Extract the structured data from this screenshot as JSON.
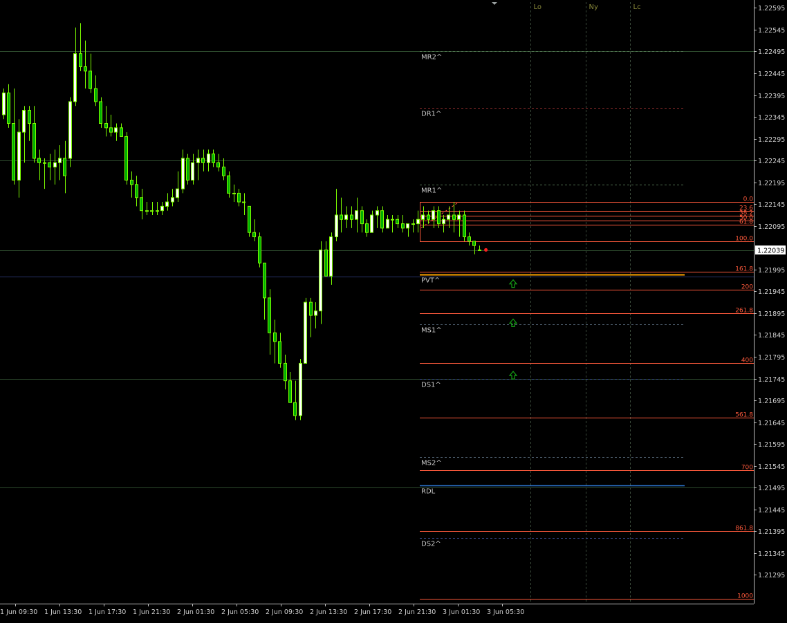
{
  "window": {
    "current_price": "1.22039"
  },
  "colors": {
    "background": "#000000",
    "candle": "#7CFC00",
    "bull_body": "#ffffff",
    "bear_body": "#00b000",
    "fib": "#ff5a3c",
    "pivot_label": "#c8c8c8",
    "session_label": "#8a8a3a",
    "pvt_line": "#ffa500",
    "rdl_line": "#2e7bd6",
    "arrow": "#15a015"
  },
  "chart_data": {
    "type": "candlestick",
    "title": "",
    "xlabel": "",
    "ylabel": "",
    "ylim": [
      1.21229,
      1.22613
    ],
    "grid": false,
    "y_ticks": [
      "1.22595",
      "1.22545",
      "1.22495",
      "1.22445",
      "1.22395",
      "1.22345",
      "1.22295",
      "1.22245",
      "1.22195",
      "1.22145",
      "1.22095",
      "1.21995",
      "1.21945",
      "1.21895",
      "1.21845",
      "1.21795",
      "1.21745",
      "1.21695",
      "1.21645",
      "1.21595",
      "1.21545",
      "1.21495",
      "1.21445",
      "1.21395",
      "1.21345",
      "1.21295"
    ],
    "x_ticks": [
      "1 Jun 09:30",
      "1 Jun 13:30",
      "1 Jun 17:30",
      "1 Jun 21:30",
      "2 Jun 01:30",
      "2 Jun 05:30",
      "2 Jun 09:30",
      "2 Jun 13:30",
      "2 Jun 17:30",
      "2 Jun 21:30",
      "3 Jun 01:30",
      "3 Jun 05:30"
    ],
    "candles": [
      [
        1.2234,
        1.2241,
        1.2235,
        1.224
      ],
      [
        1.2232,
        1.2242,
        1.224,
        1.2233
      ],
      [
        1.2219,
        1.2241,
        1.2233,
        1.222
      ],
      [
        1.2216,
        1.2234,
        1.222,
        1.2231
      ],
      [
        1.2224,
        1.2237,
        1.2231,
        1.2236
      ],
      [
        1.2229,
        1.2237,
        1.2236,
        1.2233
      ],
      [
        1.2224,
        1.2237,
        1.2233,
        1.2225
      ],
      [
        1.222,
        1.2227,
        1.2225,
        1.2224
      ],
      [
        1.2218,
        1.2225,
        1.2224,
        1.2224
      ],
      [
        1.222,
        1.2226,
        1.2224,
        1.2223
      ],
      [
        1.2219,
        1.2227,
        1.2223,
        1.2224
      ],
      [
        1.222,
        1.2228,
        1.2224,
        1.2225
      ],
      [
        1.2217,
        1.2229,
        1.2225,
        1.2221
      ],
      [
        1.2223,
        1.2239,
        1.2225,
        1.2238
      ],
      [
        1.2237,
        1.2255,
        1.2238,
        1.2249
      ],
      [
        1.2245,
        1.2256,
        1.2249,
        1.2246
      ],
      [
        1.2241,
        1.2252,
        1.2246,
        1.2245
      ],
      [
        1.224,
        1.2249,
        1.2245,
        1.2241
      ],
      [
        1.2237,
        1.2244,
        1.2241,
        1.2238
      ],
      [
        1.2232,
        1.2239,
        1.2238,
        1.2233
      ],
      [
        1.223,
        1.2237,
        1.2233,
        1.2232
      ],
      [
        1.223,
        1.2235,
        1.2232,
        1.2231
      ],
      [
        1.2229,
        1.2233,
        1.2231,
        1.2232
      ],
      [
        1.223,
        1.2233,
        1.2232,
        1.223
      ],
      [
        1.2219,
        1.2231,
        1.223,
        1.222
      ],
      [
        1.2216,
        1.2222,
        1.222,
        1.2219
      ],
      [
        1.2214,
        1.2221,
        1.2219,
        1.2216
      ],
      [
        1.2211,
        1.2218,
        1.2216,
        1.2213
      ],
      [
        1.2212,
        1.2215,
        1.2213,
        1.2213
      ],
      [
        1.2212,
        1.2215,
        1.2213,
        1.2213
      ],
      [
        1.2212,
        1.2215,
        1.2213,
        1.2213
      ],
      [
        1.2212,
        1.2215,
        1.2213,
        1.2214
      ],
      [
        1.2213,
        1.2217,
        1.2214,
        1.2215
      ],
      [
        1.2214,
        1.2218,
        1.2215,
        1.2216
      ],
      [
        1.2215,
        1.2222,
        1.2216,
        1.2218
      ],
      [
        1.2217,
        1.2227,
        1.2218,
        1.2225
      ],
      [
        1.2219,
        1.2226,
        1.2225,
        1.222
      ],
      [
        1.2219,
        1.2226,
        1.222,
        1.2224
      ],
      [
        1.222,
        1.2227,
        1.2224,
        1.2225
      ],
      [
        1.2222,
        1.2227,
        1.2225,
        1.2224
      ],
      [
        1.2222,
        1.2227,
        1.2224,
        1.2226
      ],
      [
        1.2223,
        1.2227,
        1.2226,
        1.2224
      ],
      [
        1.2222,
        1.2226,
        1.2224,
        1.2223
      ],
      [
        1.222,
        1.2225,
        1.2223,
        1.2221
      ],
      [
        1.2216,
        1.2222,
        1.2221,
        1.2217
      ],
      [
        1.2215,
        1.2219,
        1.2217,
        1.2217
      ],
      [
        1.2214,
        1.2218,
        1.2217,
        1.2215
      ],
      [
        1.2212,
        1.2217,
        1.2215,
        1.2215
      ],
      [
        1.2207,
        1.2214,
        1.2214,
        1.2208
      ],
      [
        1.2206,
        1.2211,
        1.2208,
        1.2207
      ],
      [
        1.22,
        1.2208,
        1.2207,
        1.2201
      ],
      [
        1.2188,
        1.2201,
        1.2201,
        1.2193
      ],
      [
        1.218,
        1.2195,
        1.2193,
        1.2185
      ],
      [
        1.2178,
        1.2188,
        1.2185,
        1.2183
      ],
      [
        1.2177,
        1.2185,
        1.2183,
        1.2178
      ],
      [
        1.2172,
        1.218,
        1.2178,
        1.2174
      ],
      [
        1.2169,
        1.2176,
        1.2174,
        1.2169
      ],
      [
        1.2165,
        1.2174,
        1.2169,
        1.2166
      ],
      [
        1.2165,
        1.2179,
        1.2166,
        1.2178
      ],
      [
        1.2178,
        1.2193,
        1.2178,
        1.2192
      ],
      [
        1.2184,
        1.2193,
        1.2192,
        1.2189
      ],
      [
        1.2186,
        1.2192,
        1.2189,
        1.219
      ],
      [
        1.2187,
        1.2206,
        1.219,
        1.2204
      ],
      [
        1.2198,
        1.2206,
        1.2204,
        1.2198
      ],
      [
        1.2196,
        1.2208,
        1.2198,
        1.2207
      ],
      [
        1.2206,
        1.2218,
        1.2207,
        1.2212
      ],
      [
        1.2208,
        1.2216,
        1.2212,
        1.2211
      ],
      [
        1.2209,
        1.2214,
        1.2211,
        1.2212
      ],
      [
        1.2209,
        1.2214,
        1.2212,
        1.2211
      ],
      [
        1.2208,
        1.2216,
        1.2211,
        1.2213
      ],
      [
        1.2208,
        1.2214,
        1.2213,
        1.221
      ],
      [
        1.2207,
        1.2211,
        1.221,
        1.2208
      ],
      [
        1.2208,
        1.2213,
        1.2208,
        1.2212
      ],
      [
        1.2209,
        1.2214,
        1.2212,
        1.2213
      ],
      [
        1.2208,
        1.2214,
        1.2213,
        1.2209
      ],
      [
        1.2209,
        1.2212,
        1.2209,
        1.2211
      ],
      [
        1.2208,
        1.2212,
        1.2211,
        1.2211
      ],
      [
        1.2209,
        1.2212,
        1.2211,
        1.221
      ],
      [
        1.2208,
        1.2212,
        1.221,
        1.2209
      ],
      [
        1.2207,
        1.221,
        1.2209,
        1.221
      ],
      [
        1.2208,
        1.2211,
        1.221,
        1.221
      ],
      [
        1.2208,
        1.2213,
        1.221,
        1.2211
      ],
      [
        1.2209,
        1.2214,
        1.2211,
        1.2212
      ],
      [
        1.221,
        1.2213,
        1.2212,
        1.2211
      ],
      [
        1.2209,
        1.2214,
        1.2211,
        1.2213
      ],
      [
        1.2209,
        1.2214,
        1.2213,
        1.221
      ],
      [
        1.2208,
        1.2212,
        1.221,
        1.2211
      ],
      [
        1.2209,
        1.2214,
        1.2211,
        1.2212
      ],
      [
        1.2208,
        1.2215,
        1.2212,
        1.2211
      ],
      [
        1.2207,
        1.2213,
        1.2211,
        1.2212
      ],
      [
        1.2206,
        1.2213,
        1.2212,
        1.2207
      ],
      [
        1.2205,
        1.2208,
        1.2207,
        1.2206
      ],
      [
        1.2203,
        1.2206,
        1.2206,
        1.2205
      ],
      [
        1.2204,
        1.2205,
        1.2204,
        1.2204
      ]
    ],
    "horizontal_lines": [
      {
        "price": 1.22495,
        "label": "",
        "kind": "solid_dim"
      },
      {
        "price": 1.22245,
        "label": "",
        "kind": "solid_dim"
      },
      {
        "price": 1.22039,
        "label": "",
        "kind": "solid_dim"
      },
      {
        "price": 1.21979,
        "label": "",
        "kind": "solid_blue_dim"
      },
      {
        "price": 1.21745,
        "label": "",
        "kind": "solid_dim"
      },
      {
        "price": 1.21495,
        "label": "",
        "kind": "solid_dim"
      }
    ],
    "pivot_levels": [
      {
        "label": "MR2^",
        "price": 1.22495
      },
      {
        "label": "DR1^",
        "price": 1.22365
      },
      {
        "label": "MR1^",
        "price": 1.2219
      },
      {
        "label": "PVT^",
        "price": 1.21983
      },
      {
        "label": "MS1^",
        "price": 1.2187
      },
      {
        "label": "DS1^",
        "price": 1.21745
      },
      {
        "label": "MS2^",
        "price": 1.21565
      },
      {
        "label": "RDL",
        "price": 1.215
      },
      {
        "label": "DS2^",
        "price": 1.2138
      }
    ],
    "fib_levels": [
      {
        "label": "0.0",
        "price": 1.2215
      },
      {
        "label": "23.6",
        "price": 1.2213
      },
      {
        "label": "38.2",
        "price": 1.22118
      },
      {
        "label": "50.0",
        "price": 1.22108
      },
      {
        "label": "61.8",
        "price": 1.22097
      },
      {
        "label": "100.0",
        "price": 1.2206
      },
      {
        "label": "161.8",
        "price": 1.2199
      },
      {
        "label": "200",
        "price": 1.21948
      },
      {
        "label": "261.8",
        "price": 1.21895
      },
      {
        "label": "400",
        "price": 1.2178
      },
      {
        "label": "561.8",
        "price": 1.21655
      },
      {
        "label": "700",
        "price": 1.21535
      },
      {
        "label": "861.8",
        "price": 1.21395
      },
      {
        "label": "1000",
        "price": 1.2124
      }
    ],
    "sessions": [
      "Lo",
      "Ny",
      "Lc"
    ],
    "arrows": [
      1.21962,
      1.21872,
      1.21752
    ]
  }
}
